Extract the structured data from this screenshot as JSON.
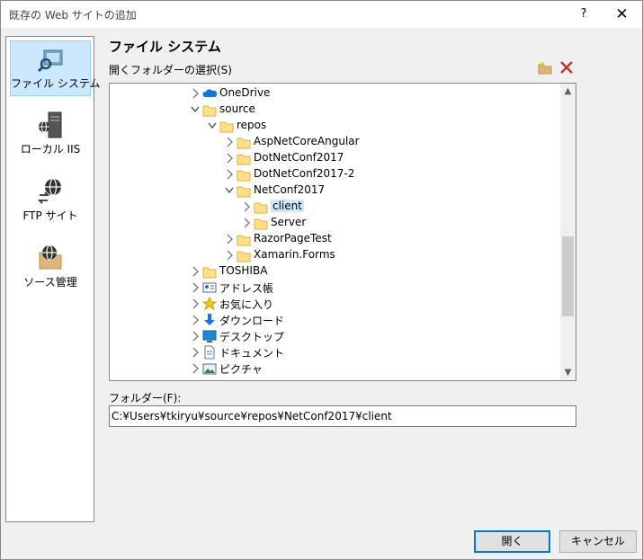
{
  "window": {
    "title": "既存の Web サイトの追加",
    "help": "?",
    "close": "✕"
  },
  "sidebar": {
    "items": [
      {
        "label": "ファイル システム",
        "icon": "file-system-icon",
        "selected": true
      },
      {
        "label": "ローカル IIS",
        "icon": "local-iis-icon",
        "selected": false
      },
      {
        "label": "FTP サイト",
        "icon": "ftp-site-icon",
        "selected": false
      },
      {
        "label": "ソース管理",
        "icon": "source-control-icon",
        "selected": false
      }
    ]
  },
  "main": {
    "heading": "ファイル システム",
    "open_folder_label": "開くフォルダーの選択(S)",
    "tree": [
      {
        "label": "OneDrive",
        "level": 2,
        "chevron": "right",
        "icon": "onedrive-icon"
      },
      {
        "label": "source",
        "level": 2,
        "chevron": "down",
        "icon": "folder-icon"
      },
      {
        "label": "repos",
        "level": 3,
        "chevron": "down",
        "icon": "folder-icon"
      },
      {
        "label": "AspNetCoreAngular",
        "level": 4,
        "chevron": "right",
        "icon": "folder-icon"
      },
      {
        "label": "DotNetConf2017",
        "level": 4,
        "chevron": "right",
        "icon": "folder-icon"
      },
      {
        "label": "DotNetConf2017-2",
        "level": 4,
        "chevron": "right",
        "icon": "folder-icon"
      },
      {
        "label": "NetConf2017",
        "level": 4,
        "chevron": "down",
        "icon": "folder-icon"
      },
      {
        "label": "client",
        "level": 5,
        "chevron": "right",
        "icon": "folder-icon",
        "selected": true
      },
      {
        "label": "Server",
        "level": 5,
        "chevron": "right",
        "icon": "folder-icon"
      },
      {
        "label": "RazorPageTest",
        "level": 4,
        "chevron": "right",
        "icon": "folder-icon"
      },
      {
        "label": "Xamarin.Forms",
        "level": 4,
        "chevron": "right",
        "icon": "folder-icon"
      },
      {
        "label": "TOSHIBA",
        "level": 2,
        "chevron": "right",
        "icon": "folder-icon"
      },
      {
        "label": "アドレス帳",
        "level": 2,
        "chevron": "right",
        "icon": "contacts-icon"
      },
      {
        "label": "お気に入り",
        "level": 2,
        "chevron": "right",
        "icon": "favorites-icon"
      },
      {
        "label": "ダウンロード",
        "level": 2,
        "chevron": "right",
        "icon": "downloads-icon"
      },
      {
        "label": "デスクトップ",
        "level": 2,
        "chevron": "right",
        "icon": "desktop-icon"
      },
      {
        "label": "ドキュメント",
        "level": 2,
        "chevron": "right",
        "icon": "documents-icon"
      },
      {
        "label": "ピクチャ",
        "level": 2,
        "chevron": "right",
        "icon": "pictures-icon"
      }
    ],
    "folder_label": "フォルダー(F):",
    "folder_value": "C:¥Users¥tkiryu¥source¥repos¥NetConf2017¥client"
  },
  "buttons": {
    "open": "開く",
    "cancel": "キャンセル"
  }
}
